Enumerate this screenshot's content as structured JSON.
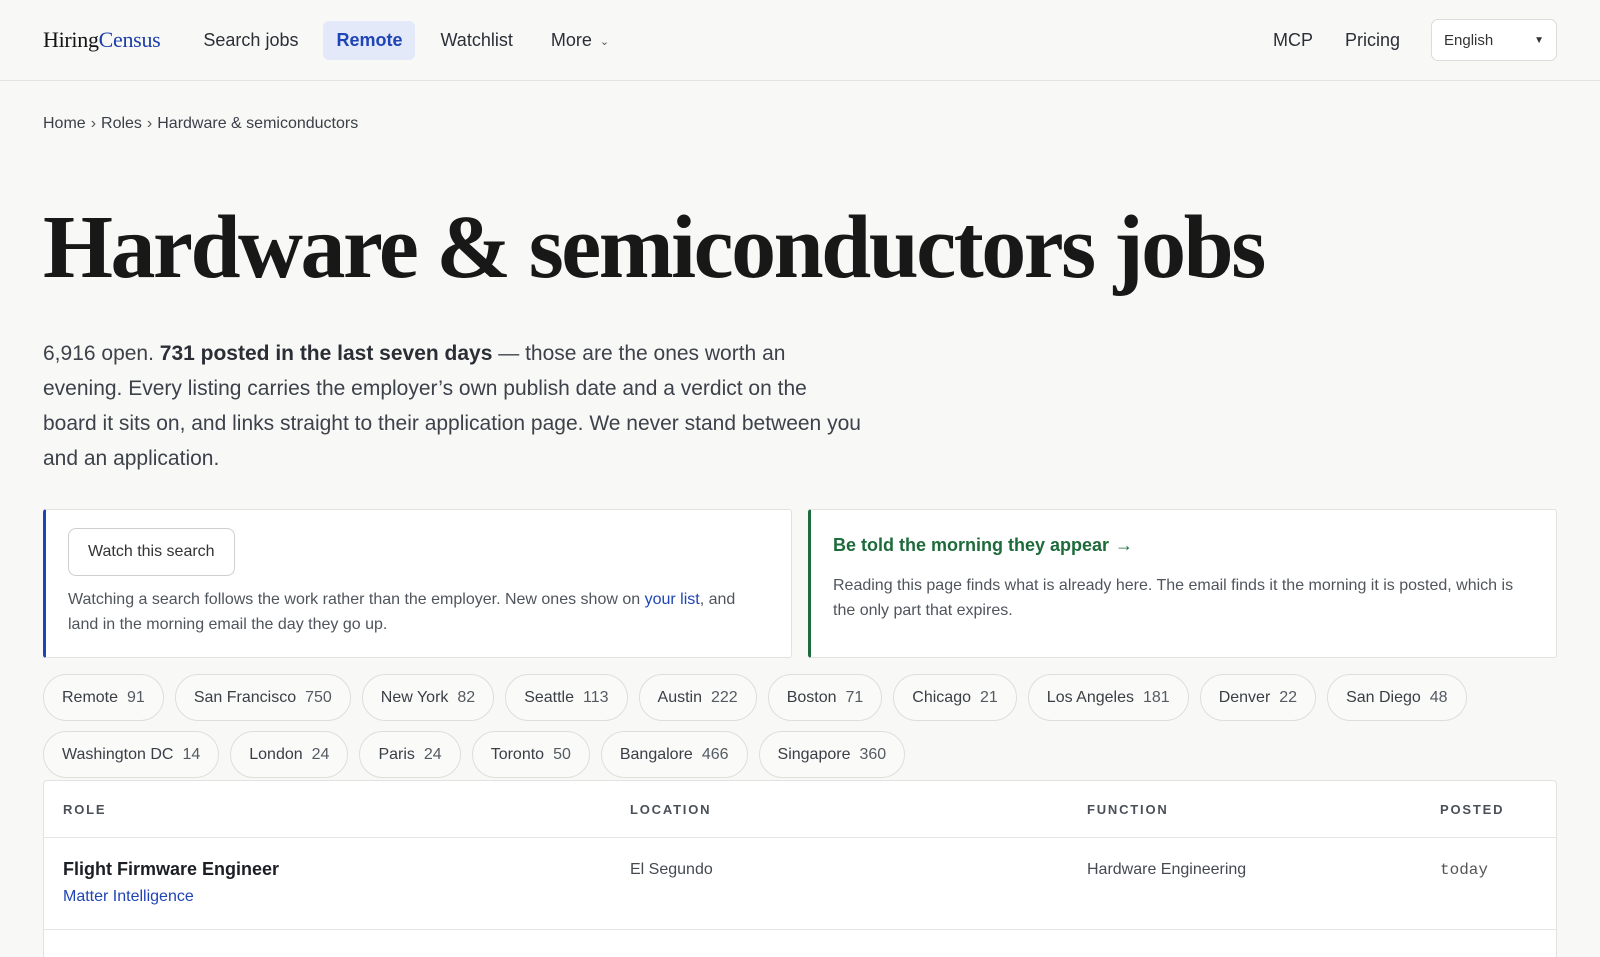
{
  "header": {
    "logo_part1": "Hiring",
    "logo_part2": "Census",
    "nav": [
      "Search jobs",
      "Remote",
      "Watchlist"
    ],
    "more_label": "More",
    "right_nav": [
      "MCP",
      "Pricing"
    ],
    "language": "English",
    "active_nav": "Remote"
  },
  "breadcrumb": [
    "Home",
    "Roles",
    "Hardware & semiconductors"
  ],
  "page_title": "Hardware & semiconductors jobs",
  "intro": {
    "lead": "6,916 open.",
    "bold": "731 posted in the last seven days",
    "rest": " — those are the ones worth an evening. Every listing carries the employer’s own publish date and a verdict on the board it sits on, and links straight to their application page. We never stand between you and an application."
  },
  "watch_card": {
    "button": "Watch this search",
    "text_before": "Watching a search follows the work rather than the employer. New ones show on ",
    "link": "your list",
    "text_after": ", and land in the morning email the day they go up."
  },
  "email_card": {
    "title": "Be told the morning they appear",
    "arrow": "→",
    "text": "Reading this page finds what is already here. The email finds it the morning it is posted, which is the only part that expires."
  },
  "location_chips": [
    {
      "name": "Remote",
      "count": "91"
    },
    {
      "name": "San Francisco",
      "count": "750"
    },
    {
      "name": "New York",
      "count": "82"
    },
    {
      "name": "Seattle",
      "count": "113"
    },
    {
      "name": "Austin",
      "count": "222"
    },
    {
      "name": "Boston",
      "count": "71"
    },
    {
      "name": "Chicago",
      "count": "21"
    },
    {
      "name": "Los Angeles",
      "count": "181"
    },
    {
      "name": "Denver",
      "count": "22"
    },
    {
      "name": "San Diego",
      "count": "48"
    },
    {
      "name": "Washington DC",
      "count": "14"
    },
    {
      "name": "London",
      "count": "24"
    },
    {
      "name": "Paris",
      "count": "24"
    },
    {
      "name": "Toronto",
      "count": "50"
    },
    {
      "name": "Bangalore",
      "count": "466"
    },
    {
      "name": "Singapore",
      "count": "360"
    }
  ],
  "table": {
    "headers": [
      "ROLE",
      "LOCATION",
      "FUNCTION",
      "POSTED"
    ],
    "rows": [
      {
        "role": "Flight Firmware Engineer",
        "company": "Matter Intelligence",
        "location": "El Segundo",
        "function": "Hardware Engineering",
        "posted": "today"
      }
    ]
  },
  "colors": {
    "accent_blue": "#1f44b5",
    "accent_green": "#1d6b3a",
    "background": "#f8f8f7"
  }
}
